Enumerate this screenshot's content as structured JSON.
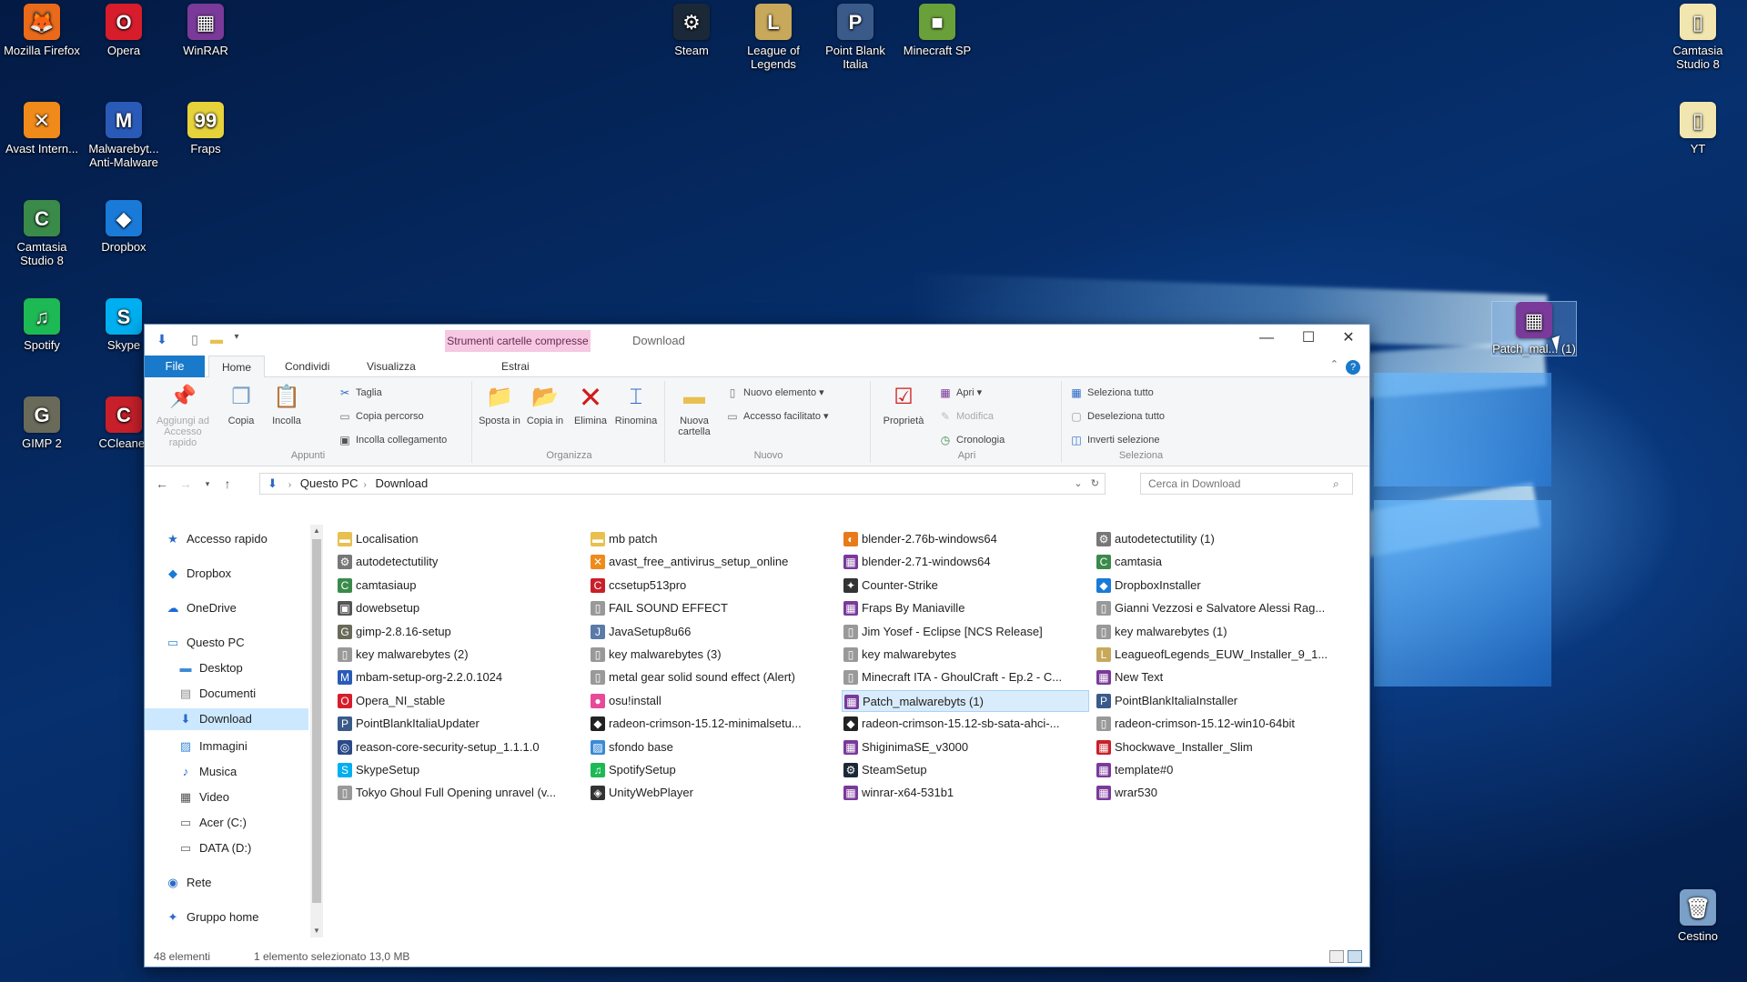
{
  "desktop": {
    "icons": [
      {
        "label": "Mozilla Firefox",
        "glyph": "🦊",
        "color": "#e86a1a"
      },
      {
        "label": "Opera",
        "glyph": "O",
        "color": "#d71d2c"
      },
      {
        "label": "WinRAR",
        "glyph": "▦",
        "color": "#7a3a9a"
      },
      {
        "label": "Steam",
        "glyph": "⚙",
        "color": "#1b2838"
      },
      {
        "label": "League of Legends",
        "glyph": "L",
        "color": "#c8a85a"
      },
      {
        "label": "Point Blank Italia",
        "glyph": "P",
        "color": "#3a5a8a"
      },
      {
        "label": "Minecraft SP",
        "glyph": "■",
        "color": "#6aa03a"
      },
      {
        "label": "Camtasia Studio 8",
        "glyph": "▯",
        "color": "#f2e6b0"
      },
      {
        "label": "Avast Intern...",
        "glyph": "✕",
        "color": "#f08a1a"
      },
      {
        "label": "Malwarebyt... Anti-Malware",
        "glyph": "M",
        "color": "#2a5ab8"
      },
      {
        "label": "Fraps",
        "glyph": "99",
        "color": "#e6d23a"
      },
      {
        "label": "YT",
        "glyph": "▯",
        "color": "#f2e6b0"
      },
      {
        "label": "Camtasia Studio 8",
        "glyph": "C",
        "color": "#3a8a4a"
      },
      {
        "label": "Dropbox",
        "glyph": "◆",
        "color": "#1a7ad8"
      },
      {
        "label": "Spotify",
        "glyph": "♫",
        "color": "#1db954"
      },
      {
        "label": "Skype",
        "glyph": "S",
        "color": "#00aff0"
      },
      {
        "label": "GIMP 2",
        "glyph": "G",
        "color": "#6a6a5a"
      },
      {
        "label": "CCleaner",
        "glyph": "C",
        "color": "#c8202a"
      },
      {
        "label": "Patch_mal... (1)",
        "glyph": "▦",
        "color": "#7a3a9a"
      },
      {
        "label": "Cestino",
        "glyph": "🗑",
        "color": "#7aa0c8"
      }
    ]
  },
  "window": {
    "context_tab": "Strumenti cartelle compresse",
    "title": "Download",
    "minimize": "—",
    "maximize": "☐",
    "close": "✕"
  },
  "ribbon_tabs": {
    "file": "File",
    "home": "Home",
    "share": "Condividi",
    "view": "Visualizza",
    "extract": "Estrai"
  },
  "ribbon": {
    "appunti": {
      "label": "Appunti",
      "pin": "Aggiungi ad Accesso rapido",
      "copy": "Copia",
      "paste": "Incolla",
      "cut": "Taglia",
      "copy_path": "Copia percorso",
      "paste_link": "Incolla collegamento"
    },
    "organizza": {
      "label": "Organizza",
      "move": "Sposta in",
      "copyto": "Copia in",
      "delete": "Elimina",
      "rename": "Rinomina"
    },
    "nuovo": {
      "label": "Nuovo",
      "new_folder": "Nuova cartella",
      "new_item": "Nuovo elemento",
      "easy_access": "Accesso facilitato"
    },
    "apri": {
      "label": "Apri",
      "properties": "Proprietà",
      "open": "Apri",
      "edit": "Modifica",
      "history": "Cronologia"
    },
    "seleziona": {
      "label": "Seleziona",
      "select_all": "Seleziona tutto",
      "select_none": "Deseleziona tutto",
      "invert": "Inverti selezione"
    }
  },
  "address": {
    "root": "Questo PC",
    "current": "Download",
    "search_placeholder": "Cerca in Download"
  },
  "navpane": [
    {
      "label": "Accesso rapido",
      "glyph": "★",
      "color": "#2a6ac8",
      "indent": 0
    },
    {
      "label": "Dropbox",
      "glyph": "◆",
      "color": "#1a7ad8",
      "indent": 0
    },
    {
      "label": "OneDrive",
      "glyph": "☁",
      "color": "#1a6ad8",
      "indent": 0
    },
    {
      "label": "Questo PC",
      "glyph": "▭",
      "color": "#3a8ad8",
      "indent": 0
    },
    {
      "label": "Desktop",
      "glyph": "▬",
      "color": "#3a8ad8",
      "indent": 1
    },
    {
      "label": "Documenti",
      "glyph": "▤",
      "color": "#8a8a8a",
      "indent": 1
    },
    {
      "label": "Download",
      "glyph": "⬇",
      "color": "#2a6ac8",
      "indent": 1
    },
    {
      "label": "Immagini",
      "glyph": "▨",
      "color": "#3a8ad8",
      "indent": 1
    },
    {
      "label": "Musica",
      "glyph": "♪",
      "color": "#2a6ac8",
      "indent": 1
    },
    {
      "label": "Video",
      "glyph": "▦",
      "color": "#555",
      "indent": 1
    },
    {
      "label": "Acer (C:)",
      "glyph": "▭",
      "color": "#666",
      "indent": 1
    },
    {
      "label": "DATA (D:)",
      "glyph": "▭",
      "color": "#666",
      "indent": 1
    },
    {
      "label": "Rete",
      "glyph": "◉",
      "color": "#2a6ac8",
      "indent": 0
    },
    {
      "label": "Gruppo home",
      "glyph": "✦",
      "color": "#2a6ac8",
      "indent": 0
    }
  ],
  "files": [
    [
      {
        "name": "Localisation",
        "glyph": "▬",
        "color": "#e8c050"
      },
      {
        "name": "autodetectutility",
        "glyph": "⚙",
        "color": "#777"
      },
      {
        "name": "camtasiaup",
        "glyph": "C",
        "color": "#3a8a4a"
      },
      {
        "name": "dowebsetup",
        "glyph": "▣",
        "color": "#555"
      },
      {
        "name": "gimp-2.8.16-setup",
        "glyph": "G",
        "color": "#6a6a5a"
      },
      {
        "name": "key malwarebytes (2)",
        "glyph": "▯",
        "color": "#999"
      },
      {
        "name": "mbam-setup-org-2.2.0.1024",
        "glyph": "M",
        "color": "#2a5ab8"
      },
      {
        "name": "Opera_NI_stable",
        "glyph": "O",
        "color": "#d71d2c"
      },
      {
        "name": "PointBlankItaliaUpdater",
        "glyph": "P",
        "color": "#3a5a8a"
      },
      {
        "name": "reason-core-security-setup_1.1.1.0",
        "glyph": "◎",
        "color": "#2a4a8a"
      },
      {
        "name": "SkypeSetup",
        "glyph": "S",
        "color": "#00aff0"
      },
      {
        "name": "Tokyo Ghoul Full Opening unravel (v...",
        "glyph": "▯",
        "color": "#999"
      }
    ],
    [
      {
        "name": "mb patch",
        "glyph": "▬",
        "color": "#e8c050"
      },
      {
        "name": "avast_free_antivirus_setup_online",
        "glyph": "✕",
        "color": "#f08a1a"
      },
      {
        "name": "ccsetup513pro",
        "glyph": "C",
        "color": "#c8202a"
      },
      {
        "name": "FAIL SOUND EFFECT",
        "glyph": "▯",
        "color": "#999"
      },
      {
        "name": "JavaSetup8u66",
        "glyph": "J",
        "color": "#5a7aa8"
      },
      {
        "name": "key malwarebytes (3)",
        "glyph": "▯",
        "color": "#999"
      },
      {
        "name": "metal gear solid sound effect (Alert)",
        "glyph": "▯",
        "color": "#999"
      },
      {
        "name": "osu!install",
        "glyph": "●",
        "color": "#e84a9a"
      },
      {
        "name": "radeon-crimson-15.12-minimalsetu...",
        "glyph": "◆",
        "color": "#222"
      },
      {
        "name": "sfondo base",
        "glyph": "▨",
        "color": "#3a8ad8"
      },
      {
        "name": "SpotifySetup",
        "glyph": "♫",
        "color": "#1db954"
      },
      {
        "name": "UnityWebPlayer",
        "glyph": "◈",
        "color": "#333"
      }
    ],
    [
      {
        "name": "blender-2.76b-windows64",
        "glyph": "◐",
        "color": "#e87a1a"
      },
      {
        "name": "blender-2.71-windows64",
        "glyph": "▦",
        "color": "#7a3a9a"
      },
      {
        "name": "Counter-Strike",
        "glyph": "✦",
        "color": "#333"
      },
      {
        "name": "Fraps By Maniaville",
        "glyph": "▦",
        "color": "#7a3a9a"
      },
      {
        "name": "Jim Yosef - Eclipse [NCS Release]",
        "glyph": "▯",
        "color": "#999"
      },
      {
        "name": "key malwarebytes",
        "glyph": "▯",
        "color": "#999"
      },
      {
        "name": "Minecraft ITA - GhoulCraft - Ep.2 - C...",
        "glyph": "▯",
        "color": "#999"
      },
      {
        "name": "Patch_malwarebyts (1)",
        "glyph": "▦",
        "color": "#7a3a9a",
        "selected": true
      },
      {
        "name": "radeon-crimson-15.12-sb-sata-ahci-...",
        "glyph": "◆",
        "color": "#222"
      },
      {
        "name": "ShiginimaSE_v3000",
        "glyph": "▦",
        "color": "#7a3a9a"
      },
      {
        "name": "SteamSetup",
        "glyph": "⚙",
        "color": "#1b2838"
      },
      {
        "name": "winrar-x64-531b1",
        "glyph": "▦",
        "color": "#7a3a9a"
      }
    ],
    [
      {
        "name": "autodetectutility (1)",
        "glyph": "⚙",
        "color": "#777"
      },
      {
        "name": "camtasia",
        "glyph": "C",
        "color": "#3a8a4a"
      },
      {
        "name": "DropboxInstaller",
        "glyph": "◆",
        "color": "#1a7ad8"
      },
      {
        "name": "Gianni Vezzosi e Salvatore Alessi Rag...",
        "glyph": "▯",
        "color": "#999"
      },
      {
        "name": "key malwarebytes (1)",
        "glyph": "▯",
        "color": "#999"
      },
      {
        "name": "LeagueofLegends_EUW_Installer_9_1...",
        "glyph": "L",
        "color": "#c8a85a"
      },
      {
        "name": "New Text",
        "glyph": "▦",
        "color": "#7a3a9a"
      },
      {
        "name": "PointBlankItaliaInstaller",
        "glyph": "P",
        "color": "#3a5a8a"
      },
      {
        "name": "radeon-crimson-15.12-win10-64bit",
        "glyph": "▯",
        "color": "#999"
      },
      {
        "name": "Shockwave_Installer_Slim",
        "glyph": "▦",
        "color": "#c8202a"
      },
      {
        "name": "template#0",
        "glyph": "▦",
        "color": "#7a3a9a"
      },
      {
        "name": "wrar530",
        "glyph": "▦",
        "color": "#7a3a9a"
      }
    ]
  ],
  "status": {
    "count": "48 elementi",
    "selection": "1 elemento selezionato  13,0 MB"
  }
}
